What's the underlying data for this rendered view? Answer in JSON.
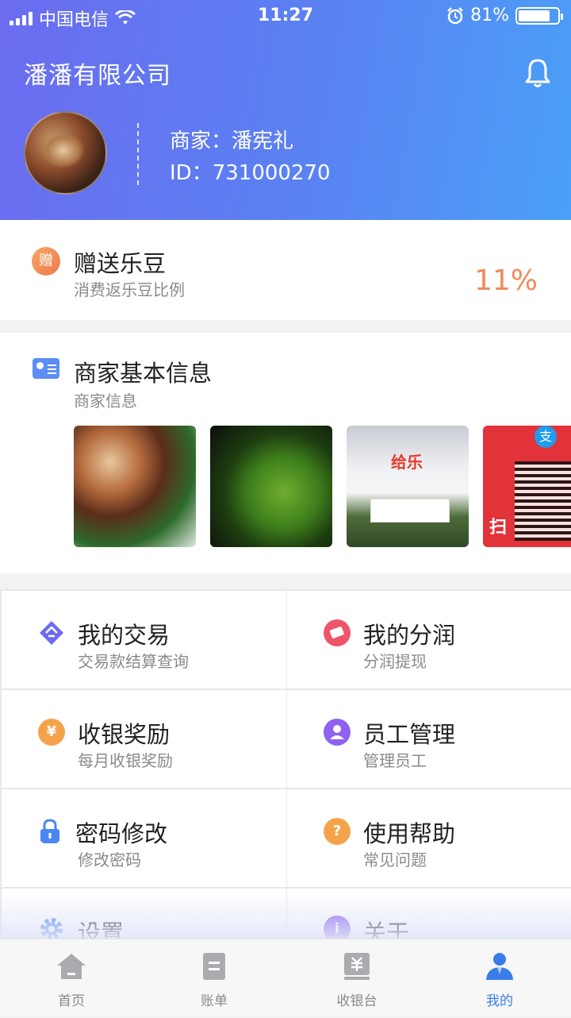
{
  "status_bar": {
    "carrier": "中国电信",
    "time": "11:27",
    "battery": "81%"
  },
  "header": {
    "company": "潘潘有限公司",
    "merchant_line": "商家：潘宪礼",
    "id_line": "ID：731000270"
  },
  "gift": {
    "title": "赠送乐豆",
    "subtitle": "消费返乐豆比例",
    "icon_char": "赠",
    "percent": "11%"
  },
  "info": {
    "title": "商家基本信息",
    "subtitle": "商家信息",
    "photo3_logo": "给乐",
    "photo4_scan": "扫",
    "photo4_badge": "支"
  },
  "menu": [
    {
      "title": "我的交易",
      "subtitle": "交易款结算查询",
      "icon": "transaction-icon",
      "color": "#6d6bf0"
    },
    {
      "title": "我的分润",
      "subtitle": "分润提现",
      "icon": "share-profit-icon",
      "color": "#f0546a"
    },
    {
      "title": "收银奖励",
      "subtitle": "每月收银奖励",
      "icon": "yuan-reward-icon",
      "color": "#f5a34b",
      "icon_char": "¥"
    },
    {
      "title": "员工管理",
      "subtitle": "管理员工",
      "icon": "staff-icon",
      "color": "#8e61f0"
    },
    {
      "title": "密码修改",
      "subtitle": "修改密码",
      "icon": "lock-icon",
      "color": "#4c86f3"
    },
    {
      "title": "使用帮助",
      "subtitle": "常见问题",
      "icon": "help-icon",
      "color": "#f5a34b",
      "icon_char": "?"
    },
    {
      "title": "设置",
      "subtitle": "",
      "icon": "settings-icon",
      "color": "#4c86f3"
    },
    {
      "title": "关于",
      "subtitle": "",
      "icon": "info-icon",
      "color": "#8e61f0",
      "icon_char": "i"
    }
  ],
  "tabbar": [
    {
      "label": "首页",
      "icon": "home-icon"
    },
    {
      "label": "账单",
      "icon": "bill-icon"
    },
    {
      "label": "收银台",
      "icon": "cashier-icon"
    },
    {
      "label": "我的",
      "icon": "profile-icon",
      "active": true
    }
  ]
}
